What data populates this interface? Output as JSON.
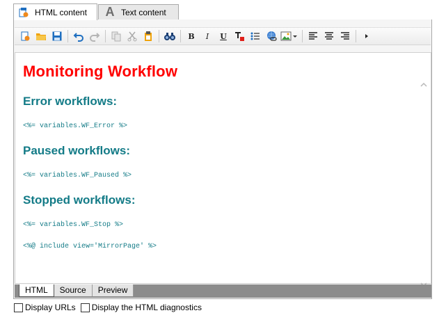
{
  "tabs": [
    {
      "label": "HTML content",
      "icon": "html-document-icon"
    },
    {
      "label": "Text content",
      "icon": "text-a-icon"
    }
  ],
  "toolbar": {
    "icons": [
      "new-document-icon",
      "open-folder-icon",
      "save-icon",
      "undo-icon",
      "redo-icon",
      "copy-icon",
      "cut-icon",
      "paste-icon",
      "find-icon",
      "bold-icon",
      "italic-icon",
      "underline-icon",
      "text-color-icon",
      "bullet-list-icon",
      "insert-link-icon",
      "insert-image-icon",
      "align-left-icon",
      "align-center-icon",
      "align-right-icon",
      "more-icon"
    ],
    "bold": "B",
    "italic": "I",
    "underline": "U"
  },
  "document": {
    "title": "Monitoring Workflow",
    "sections": [
      {
        "heading": "Error workflows:",
        "code": "<%= variables.WF_Error %>"
      },
      {
        "heading": "Paused workflows:",
        "code": "<%= variables.WF_Paused %>"
      },
      {
        "heading": "Stopped workflows:",
        "code": "<%= variables.WF_Stop %>"
      }
    ],
    "footer_code": "<%@ include view='MirrorPage' %>"
  },
  "bottom_tabs": [
    "HTML",
    "Source",
    "Preview"
  ],
  "options": [
    {
      "label": "Display URLs",
      "checked": false
    },
    {
      "label": "Display the HTML diagnostics",
      "checked": false
    }
  ],
  "colors": {
    "title": "#ff0000",
    "heading": "#137b87",
    "toolbar_icon_blue": "#1f6fc0",
    "folder": "#f0a30a"
  }
}
